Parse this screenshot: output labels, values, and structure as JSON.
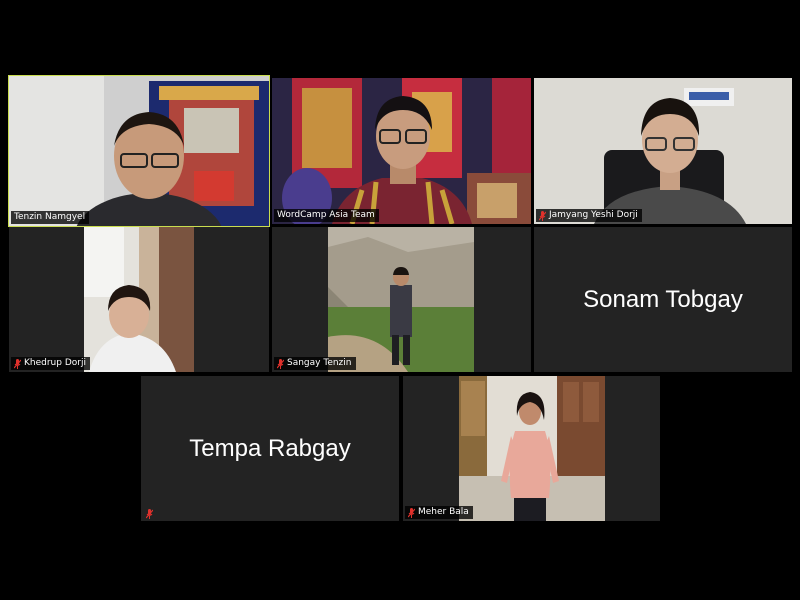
{
  "participants": [
    {
      "name": "Tenzin Namgyel",
      "muted": false,
      "active_speaker": true
    },
    {
      "name": "WordCamp Asia Team",
      "muted": false,
      "active_speaker": false
    },
    {
      "name": "Jamyang Yeshi Dorji",
      "muted": true,
      "active_speaker": false
    },
    {
      "name": "Khedrup Dorji",
      "muted": true,
      "active_speaker": false
    },
    {
      "name": "Sangay Tenzin",
      "muted": true,
      "active_speaker": false
    },
    {
      "name": "Sonam Tobgay",
      "muted": false,
      "active_speaker": false,
      "video_off": true
    },
    {
      "name": "Tempa Rabgay",
      "muted": true,
      "active_speaker": false,
      "video_off": true
    },
    {
      "name": "Meher Bala",
      "muted": true,
      "active_speaker": false
    }
  ],
  "colors": {
    "background": "#000000",
    "tile": "#232323",
    "active_border": "#c9dd4f",
    "mute_icon": "#e0312c"
  }
}
